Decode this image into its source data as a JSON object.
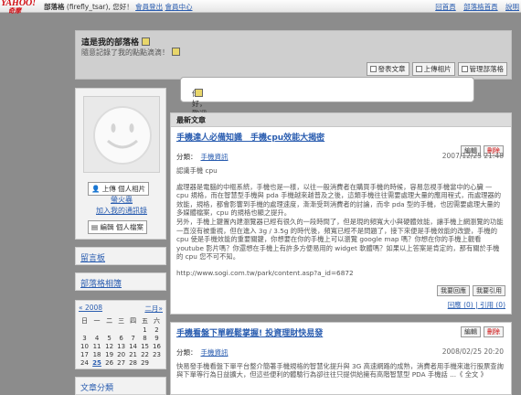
{
  "topbar": {
    "logo": "YAHOO!",
    "logo_sub": "奇摩",
    "service_label": "部落格",
    "greeting": "(firefly_tsar), 您好！",
    "logout": "會員登出",
    "member_center": "會員中心",
    "right_links": [
      "回首頁",
      "部落格首頁",
      "說明"
    ]
  },
  "header": {
    "title": "這是我的部落格",
    "subtitle": "隨意記錄了我的點點滴滴！",
    "buttons": [
      "發表文章",
      "上傳相片",
      "管理部落格"
    ]
  },
  "bubble": {
    "text": "你好，歡迎參觀我的部落格！"
  },
  "profile": {
    "upload_button": "上傳 個人相片",
    "nickname": "螢火蟲",
    "pin_label": "加入我的通訊錄",
    "edit_button": "編輯 個人檔案"
  },
  "sidebar": {
    "guestbook": "留言板",
    "album": "部落格相簿",
    "last": "文章分類"
  },
  "calendar": {
    "prev": "« 2008",
    "next": "二月»",
    "weekdays": [
      "日",
      "一",
      "二",
      "三",
      "四",
      "五",
      "六"
    ],
    "rows": [
      [
        "",
        "",
        "",
        "",
        "",
        "1",
        "2"
      ],
      [
        "3",
        "4",
        "5",
        "6",
        "7",
        "8",
        "9"
      ],
      [
        "10",
        "11",
        "12",
        "13",
        "14",
        "15",
        "16"
      ],
      [
        "17",
        "18",
        "19",
        "20",
        "21",
        "22",
        "23"
      ],
      [
        "24",
        "25",
        "26",
        "27",
        "28",
        "29",
        ""
      ]
    ],
    "highlight": "25"
  },
  "main": {
    "heading": "最新文章",
    "posts": [
      {
        "title": "手機達人必備知識　手機cpu效能大揭密",
        "edit": "編輯",
        "delete": "刪除",
        "category_label": "分類：",
        "category": "手機資訊",
        "date": "2007/12/25 21:48",
        "paragraphs": [
          "認識手機 cpu",
          "處理器是電腦的中樞系統，手機也是一樣，以往一般消費者在購買手機的時候，容易忽視手機當中的心臟 — cpu 規格，而在智慧型手機與 pda 手機越來越普及之後，這類手機往往需要處理大量的應用程式，而處理器的效能，規格，都會影響到手機的處理速度，漸漸受到消費者的討論，而非 pda 型的手機，也因需要處理大量的多媒體檔案，cpu 的規格也顯之提升。",
          "另外，手機上鍵置內建瀏覽器已經有很久的一段時間了，但是現的頻寬大小與硬體效能，讓手機上網瀏覽的功能一直沒有被重視，但在進入 3g / 3.5g 的時代後，頻寬已經不是問題了，接下來便是手機效能的改變，手機的 cpu 使是手機效能的重要關鍵，你想要在你的手機上可以瀏覽 google map 嗎？你想在你的手機上觀看 youtube 影片嗎？你還想在手機上有許多方便易用的 widget 軟體嗎？如果以上答案是肯定的，那有關於手機的 cpu 您不可不知。",
          "http://www.sogi.com.tw/park/content.asp?a_id=6872"
        ],
        "reply": "我要回應",
        "quote": "我要引用",
        "reply_count": "回應 (0) | 引用 (0)"
      },
      {
        "title": "手機看盤下單輕鬆掌握! 投資理財快易發",
        "edit": "編輯",
        "delete": "刪除",
        "category_label": "分類：",
        "category": "手機資訊",
        "date": "2008/02/25 20:20",
        "body": "快易發手機看盤下單平台整介簡著手機規格的智慧化提升與 3G 高速網路的成熟，消費者用手機來進行股票查詢與下單等行為日益擴大，但這些便利的體驗行為卻往往只提供給擁有高階智慧型 PDA 手機話 ...《 全文 》"
      }
    ]
  },
  "colors": {
    "link": "#2a5db0",
    "delete": "#cc0000",
    "logo": "#d10a10",
    "panel_head": "#dcdcdc"
  }
}
